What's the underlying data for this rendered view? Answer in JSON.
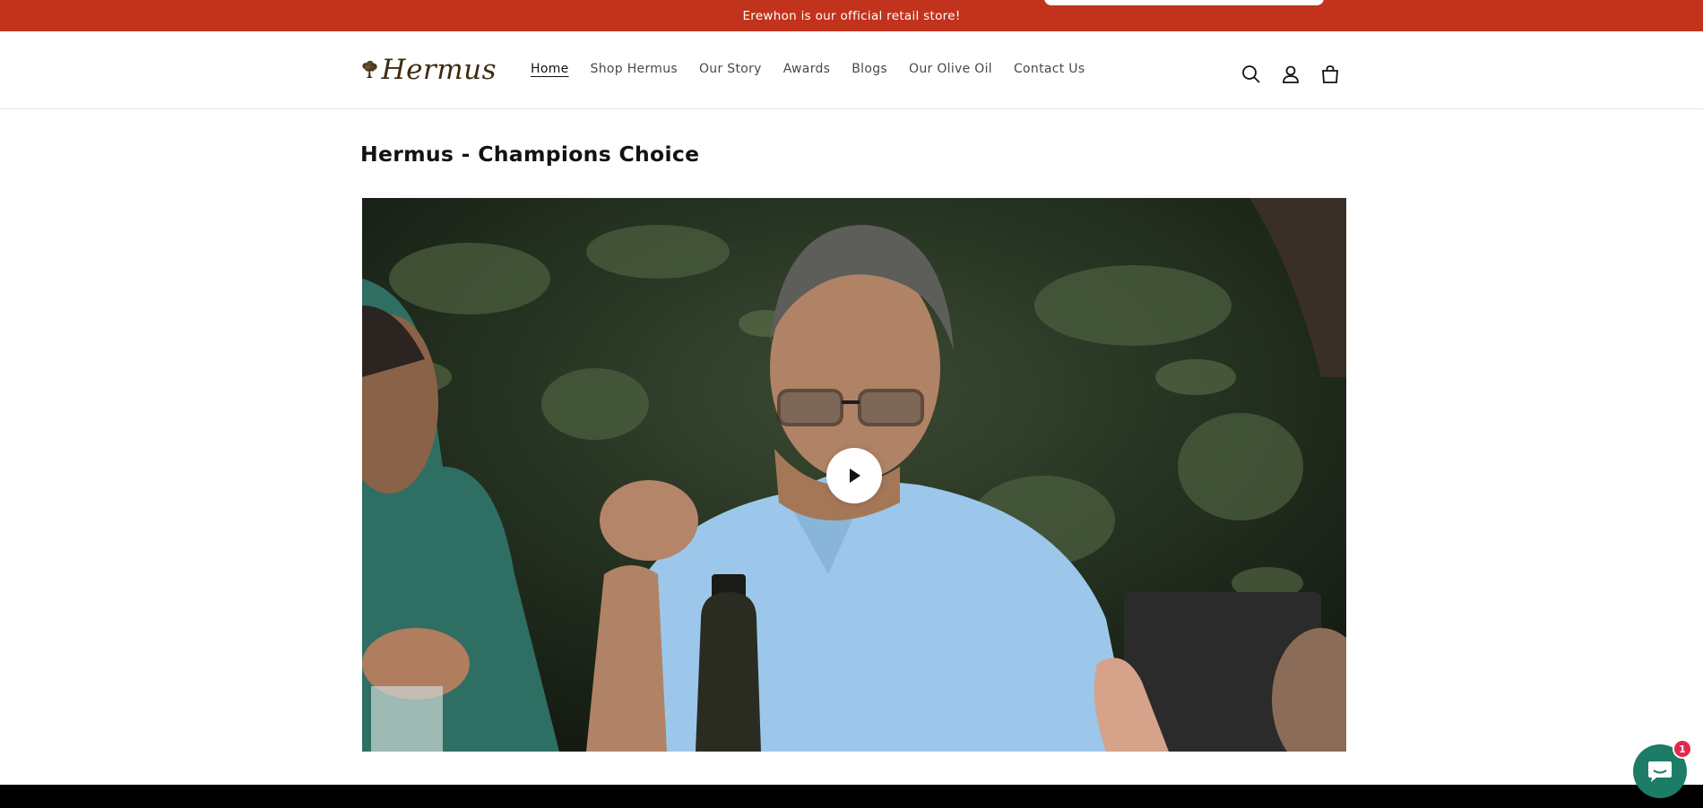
{
  "announcement": {
    "text": "Erewhon is our official retail store!"
  },
  "header": {
    "logo_text": "Hermus",
    "nav": [
      {
        "label": "Home",
        "active": true
      },
      {
        "label": "Shop Hermus",
        "active": false
      },
      {
        "label": "Our Story",
        "active": false
      },
      {
        "label": "Awards",
        "active": false
      },
      {
        "label": "Blogs",
        "active": false
      },
      {
        "label": "Our Olive Oil",
        "active": false
      },
      {
        "label": "Contact Us",
        "active": false
      }
    ],
    "icons": [
      "search-icon",
      "account-icon",
      "cart-icon"
    ]
  },
  "main": {
    "title": "Hermus - Champions Choice",
    "video": {
      "play_icon": "play-icon"
    }
  },
  "chat": {
    "icon": "chat-icon",
    "badge_count": "1"
  },
  "colors": {
    "announcement_bg": "#c1331c",
    "chat_bg": "#1c7c65",
    "badge_bg": "#e4284b"
  }
}
